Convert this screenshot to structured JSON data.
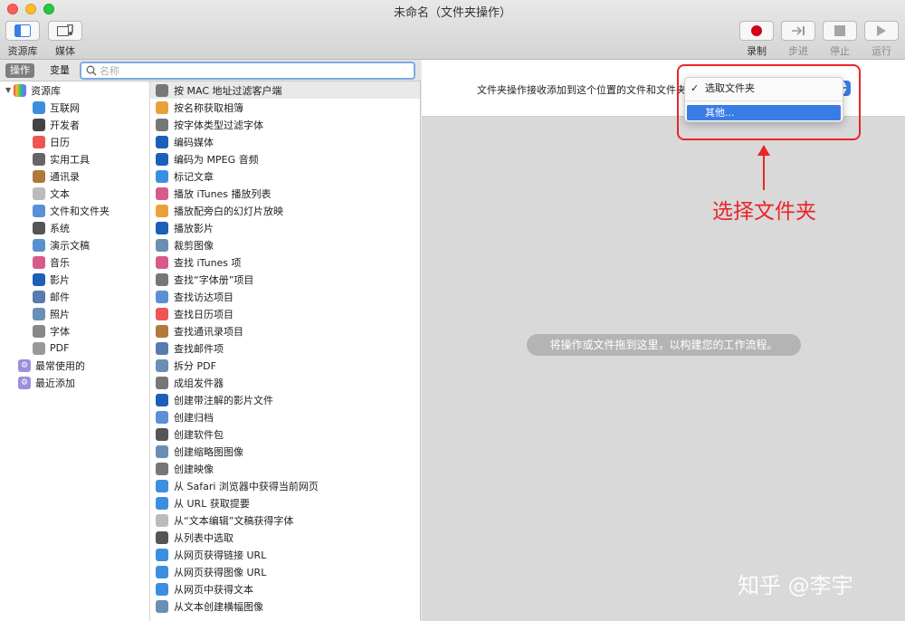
{
  "window": {
    "title": "未命名（文件夹操作）"
  },
  "toolbar": {
    "library_label": "资源库",
    "media_label": "媒体",
    "record_label": "录制",
    "step_label": "步进",
    "stop_label": "停止",
    "run_label": "运行"
  },
  "tabs": {
    "actions": "操作",
    "variables": "变量"
  },
  "search": {
    "placeholder": "名称",
    "value": ""
  },
  "library": {
    "root": "资源库",
    "items": [
      "互联网",
      "开发者",
      "日历",
      "实用工具",
      "通讯录",
      "文本",
      "文件和文件夹",
      "系统",
      "演示文稿",
      "音乐",
      "影片",
      "邮件",
      "照片",
      "字体",
      "PDF"
    ],
    "smart": [
      "最常使用的",
      "最近添加"
    ]
  },
  "actions": [
    "按 MAC 地址过滤客户端",
    "按名称获取相簿",
    "按字体类型过滤字体",
    "编码媒体",
    "编码为 MPEG 音频",
    "标记文章",
    "播放 iTunes 播放列表",
    "播放配旁白的幻灯片放映",
    "播放影片",
    "裁剪图像",
    "查找 iTunes 项",
    "查找“字体册”项目",
    "查找访达项目",
    "查找日历项目",
    "查找通讯录项目",
    "查找邮件项",
    "拆分 PDF",
    "成组发件器",
    "创建带注解的影片文件",
    "创建归档",
    "创建软件包",
    "创建缩略图图像",
    "创建映像",
    "从 Safari 浏览器中获得当前网页",
    "从 URL 获取提要",
    "从“文本编辑”文稿获得字体",
    "从列表中选取",
    "从网页获得链接 URL",
    "从网页获得图像 URL",
    "从网页中获得文本",
    "从文本创建横幅图像"
  ],
  "workflow": {
    "receive_label": "文件夹操作接收添加到这个位置的文件和文件夹",
    "drop_hint": "将操作或文件拖到这里，以构建您的工作流程。"
  },
  "dropdown": {
    "selected_item": "选取文件夹",
    "other_item": "其他..."
  },
  "annotation": {
    "text": "选择文件夹",
    "color": "#e8252a"
  },
  "watermark": "知乎 @李宇",
  "colors": {
    "accent": "#3a7ce6",
    "record": "#d0021b",
    "annotation": "#e8252a"
  }
}
